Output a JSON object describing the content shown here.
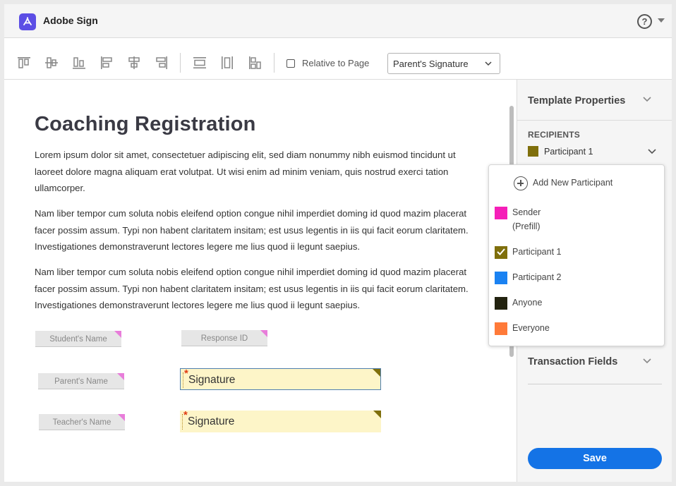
{
  "header": {
    "app_title": "Adobe Sign",
    "help_icon_glyph": "?"
  },
  "toolbar": {
    "icons": [
      "align-top-icon",
      "align-middle-icon",
      "align-bottom-icon",
      "align-left-icon",
      "align-center-icon",
      "align-right-icon",
      "distribute-vertical-icon",
      "distribute-horizontal-icon",
      "match-size-icon"
    ],
    "relative_to_page_label": "Relative to Page",
    "relative_to_page_checked": false,
    "recipient_select_value": "Parent's Signature"
  },
  "document": {
    "title": "Coaching Registration",
    "paragraphs": [
      "Lorem ipsum dolor sit amet, consectetuer adipiscing elit, sed diam nonummy nibh euismod tincidunt ut laoreet dolore magna aliquam erat volutpat. Ut wisi enim ad minim veniam, quis nostrud exerci tation ullamcorper.",
      "Nam liber tempor cum soluta nobis eleifend option congue nihil imperdiet doming id quod mazim placerat facer possim assum. Typi non habent claritatem insitam; est usus legentis in iis qui facit eorum claritatem. Investigationes demonstraverunt lectores legere me lius quod ii legunt saepius.",
      "Nam liber tempor cum soluta nobis eleifend option congue nihil imperdiet doming id quod mazim placerat facer possim assum. Typi non habent claritatem insitam; est usus legentis in iis qui facit eorum claritatem. Investigationes demonstraverunt lectores legere me lius quod ii legunt saepius."
    ],
    "fields": {
      "students_name": "Student's Name",
      "response_id": "Response ID",
      "parents_name": "Parent's Name",
      "teachers_name": "Teacher's Name",
      "parent_signature": "Signature",
      "teacher_signature": "Signature",
      "required_marker": "*"
    }
  },
  "panel": {
    "template_properties": "Template Properties",
    "recipients_heading": "RECIPIENTS",
    "current_recipient": "Participant 1",
    "transaction_fields": "Transaction Fields",
    "save_label": "Save"
  },
  "dropdown": {
    "add_participant": "Add New Participant",
    "items": [
      {
        "label": "Sender\n(Prefill)",
        "color": "#f51fb8"
      },
      {
        "label": "Participant 1",
        "color": "#7f6f0c",
        "selected": true
      },
      {
        "label": "Participant 2",
        "color": "#1a82f2"
      },
      {
        "label": "Anyone",
        "color": "#232310"
      },
      {
        "label": "Everyone",
        "color": "#ff7a39"
      }
    ]
  },
  "colors": {
    "accent": "#1473e6",
    "logo": "#5c4ee5",
    "signature_fill": "#fdf5c8",
    "field_corner": "#e87dda"
  }
}
